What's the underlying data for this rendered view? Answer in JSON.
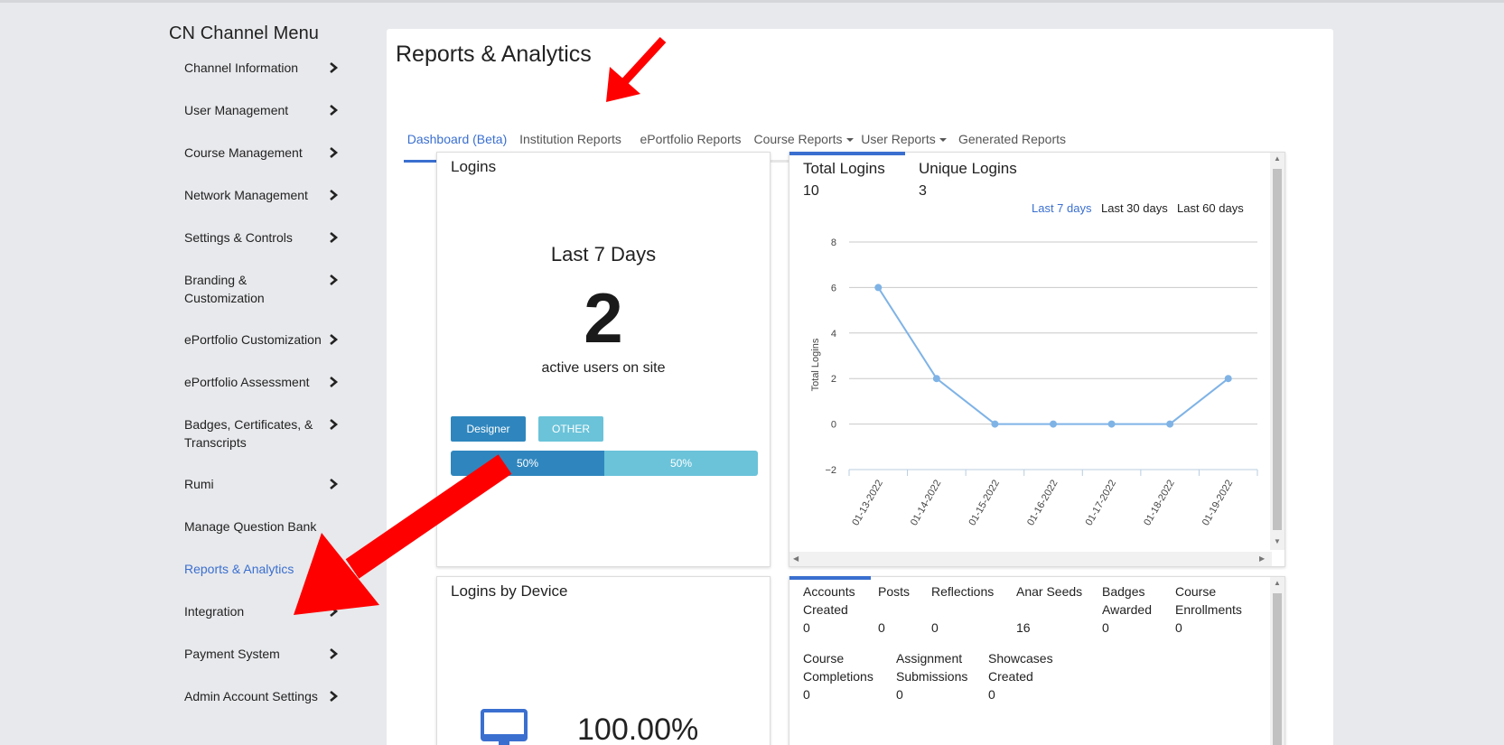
{
  "sidebar": {
    "title": "CN Channel Menu",
    "items": [
      {
        "label": "Channel Information",
        "icon": "chevron-right-icon"
      },
      {
        "label": "User Management",
        "icon": "chevron-right-icon"
      },
      {
        "label": "Course Management",
        "icon": "chevron-right-icon"
      },
      {
        "label": "Network Management",
        "icon": "chevron-right-icon"
      },
      {
        "label": "Settings & Controls",
        "icon": "chevron-right-icon"
      },
      {
        "label": "Branding &",
        "label2": "Customization",
        "icon": "chevron-right-icon"
      },
      {
        "label": "ePortfolio Customization",
        "icon": "chevron-right-icon"
      },
      {
        "label": "ePortfolio Assessment",
        "icon": "chevron-right-icon"
      },
      {
        "label": "Badges, Certificates, &",
        "label2": "Transcripts",
        "icon": "chevron-right-icon"
      },
      {
        "label": "Rumi",
        "icon": "chevron-right-icon"
      },
      {
        "label": "Manage Question Bank"
      },
      {
        "label": "Reports & Analytics",
        "active": true
      },
      {
        "label": "Integration",
        "icon": "chevron-right-icon"
      },
      {
        "label": "Payment System",
        "icon": "chevron-right-icon"
      },
      {
        "label": "Admin Account Settings",
        "icon": "chevron-right-icon"
      }
    ]
  },
  "main": {
    "title": "Reports & Analytics",
    "tabs": [
      {
        "label": "Dashboard (Beta)",
        "active": true
      },
      {
        "label": "Institution Reports"
      },
      {
        "label": "ePortfolio Reports"
      },
      {
        "label": "Course Reports",
        "dropdown": true
      },
      {
        "label": "User Reports",
        "dropdown": true
      },
      {
        "label": "Generated Reports"
      }
    ]
  },
  "logins_card": {
    "title": "Logins",
    "period": "Last 7 Days",
    "count": "2",
    "subtitle": "active users on site",
    "roles": [
      {
        "label": "Designer",
        "color": "#2f86be"
      },
      {
        "label": "OTHER",
        "color": "#6ac3d9"
      }
    ],
    "bar": [
      {
        "label": "50%",
        "value": 50,
        "color": "#2f86be"
      },
      {
        "label": "50%",
        "value": 50,
        "color": "#6ac3d9"
      }
    ]
  },
  "chart_card": {
    "total_label": "Total Logins",
    "total_value": "10",
    "unique_label": "Unique Logins",
    "unique_value": "3",
    "ranges": [
      {
        "label": "Last 7 days",
        "active": true
      },
      {
        "label": "Last 30 days"
      },
      {
        "label": "Last 60 days"
      }
    ]
  },
  "chart_data": {
    "type": "line",
    "categories": [
      "01-13-2022",
      "01-14-2022",
      "01-15-2022",
      "01-16-2022",
      "01-17-2022",
      "01-18-2022",
      "01-19-2022"
    ],
    "series": [
      {
        "values": [
          6,
          2,
          0,
          0,
          0,
          0,
          2
        ],
        "color": "#7fb3e6"
      }
    ],
    "title": "",
    "xlabel": "",
    "ylabel": "Total Logins",
    "ylim": [
      -2,
      8
    ],
    "yticks": [
      "8",
      "6",
      "4",
      "2",
      "0",
      "−2"
    ],
    "grid": true
  },
  "device_card": {
    "title": "Logins by Device",
    "icon": "monitor-icon",
    "percent": "100.00%"
  },
  "stats_card": {
    "stats": [
      {
        "label": "Accounts",
        "label2": "Created",
        "value": "0"
      },
      {
        "label": "Posts",
        "value": "0"
      },
      {
        "label": "Reflections",
        "value": "0"
      },
      {
        "label": "Anar Seeds",
        "value": "16"
      },
      {
        "label": "Badges",
        "label2": "Awarded",
        "value": "0"
      },
      {
        "label": "Course",
        "label2": "Enrollments",
        "value": "0"
      },
      {
        "label": "Course",
        "label2": "Completions",
        "value": "0"
      },
      {
        "label": "Assignment",
        "label2": "Submissions",
        "value": "0"
      },
      {
        "label": "Showcases",
        "label2": "Created",
        "value": "0"
      }
    ]
  },
  "annotations": {
    "arrow_color": "#ff0000"
  }
}
